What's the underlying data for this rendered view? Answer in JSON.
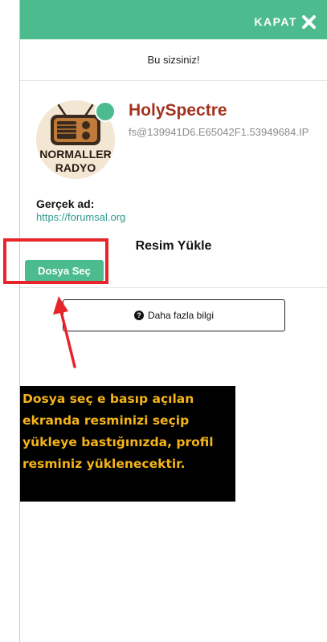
{
  "header": {
    "close_label": "KAPAT",
    "accent_color": "#4cbc8f"
  },
  "greeting": "Bu sizsiniz!",
  "profile": {
    "username": "HolySpectre",
    "user_id": "fs@139941D6.E65042F1.53949684.IP",
    "avatar_text_top": "NORMALLER",
    "avatar_text_bottom": "RADYO",
    "status": "online",
    "real_name_label": "Gerçek ad:",
    "real_name_value": "https://forumsal.org"
  },
  "upload": {
    "title": "Resim Yükle",
    "choose_button": "Dosya Seç"
  },
  "more_info_button": "Daha fazla bilgi",
  "annotation": {
    "text": "Dosya seç e basıp açılan ekranda resminizi seçip yükleye bastığınızda, profil resminiz yüklenecektir.",
    "highlight_color": "#e8242b",
    "text_color": "#f5b41a"
  }
}
